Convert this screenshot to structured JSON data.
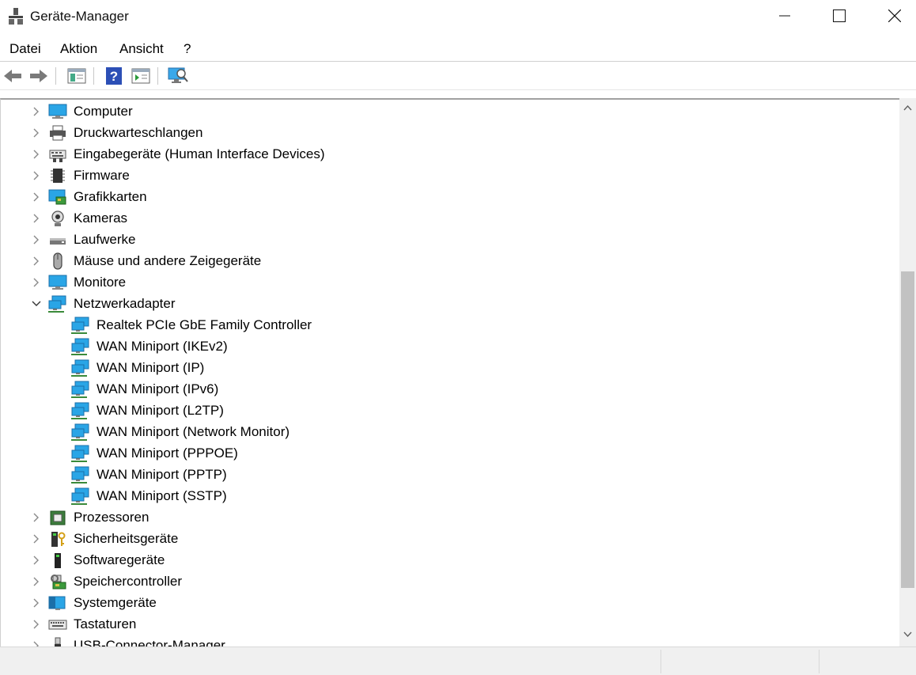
{
  "window": {
    "title": "Geräte-Manager"
  },
  "menu": [
    "Datei",
    "Aktion",
    "Ansicht",
    "?"
  ],
  "toolbar": [
    "back-icon",
    "forward-icon",
    "show-hide-tree-icon",
    "help-icon",
    "properties-icon",
    "scan-hardware-icon"
  ],
  "tree": [
    {
      "label": "Computer",
      "icon": "computer-icon",
      "level": 0,
      "expanded": false
    },
    {
      "label": "Druckwarteschlangen",
      "icon": "printer-icon",
      "level": 0,
      "expanded": false
    },
    {
      "label": "Eingabegeräte (Human Interface Devices)",
      "icon": "hid-icon",
      "level": 0,
      "expanded": false
    },
    {
      "label": "Firmware",
      "icon": "firmware-icon",
      "level": 0,
      "expanded": false
    },
    {
      "label": "Grafikkarten",
      "icon": "display-adapter-icon",
      "level": 0,
      "expanded": false
    },
    {
      "label": "Kameras",
      "icon": "camera-icon",
      "level": 0,
      "expanded": false
    },
    {
      "label": "Laufwerke",
      "icon": "disk-drive-icon",
      "level": 0,
      "expanded": false
    },
    {
      "label": "Mäuse und andere Zeigegeräte",
      "icon": "mouse-icon",
      "level": 0,
      "expanded": false
    },
    {
      "label": "Monitore",
      "icon": "monitor-icon",
      "level": 0,
      "expanded": false
    },
    {
      "label": "Netzwerkadapter",
      "icon": "network-adapter-icon",
      "level": 0,
      "expanded": true
    },
    {
      "label": "Realtek PCIe GbE Family Controller",
      "icon": "network-adapter-icon",
      "level": 1
    },
    {
      "label": "WAN Miniport (IKEv2)",
      "icon": "network-adapter-icon",
      "level": 1
    },
    {
      "label": "WAN Miniport (IP)",
      "icon": "network-adapter-icon",
      "level": 1
    },
    {
      "label": "WAN Miniport (IPv6)",
      "icon": "network-adapter-icon",
      "level": 1
    },
    {
      "label": "WAN Miniport (L2TP)",
      "icon": "network-adapter-icon",
      "level": 1
    },
    {
      "label": "WAN Miniport (Network Monitor)",
      "icon": "network-adapter-icon",
      "level": 1
    },
    {
      "label": "WAN Miniport (PPPOE)",
      "icon": "network-adapter-icon",
      "level": 1
    },
    {
      "label": "WAN Miniport (PPTP)",
      "icon": "network-adapter-icon",
      "level": 1
    },
    {
      "label": "WAN Miniport (SSTP)",
      "icon": "network-adapter-icon",
      "level": 1
    },
    {
      "label": "Prozessoren",
      "icon": "processor-icon",
      "level": 0,
      "expanded": false
    },
    {
      "label": "Sicherheitsgeräte",
      "icon": "security-device-icon",
      "level": 0,
      "expanded": false
    },
    {
      "label": "Softwaregeräte",
      "icon": "software-device-icon",
      "level": 0,
      "expanded": false
    },
    {
      "label": "Speichercontroller",
      "icon": "storage-controller-icon",
      "level": 0,
      "expanded": false
    },
    {
      "label": "Systemgeräte",
      "icon": "system-device-icon",
      "level": 0,
      "expanded": false
    },
    {
      "label": "Tastaturen",
      "icon": "keyboard-icon",
      "level": 0,
      "expanded": false
    },
    {
      "label": "USB-Connector-Manager",
      "icon": "usb-icon",
      "level": 0,
      "expanded": false
    }
  ],
  "colors": {
    "accent": "#1e90d8",
    "monitor_screen": "#2aa5e6"
  }
}
